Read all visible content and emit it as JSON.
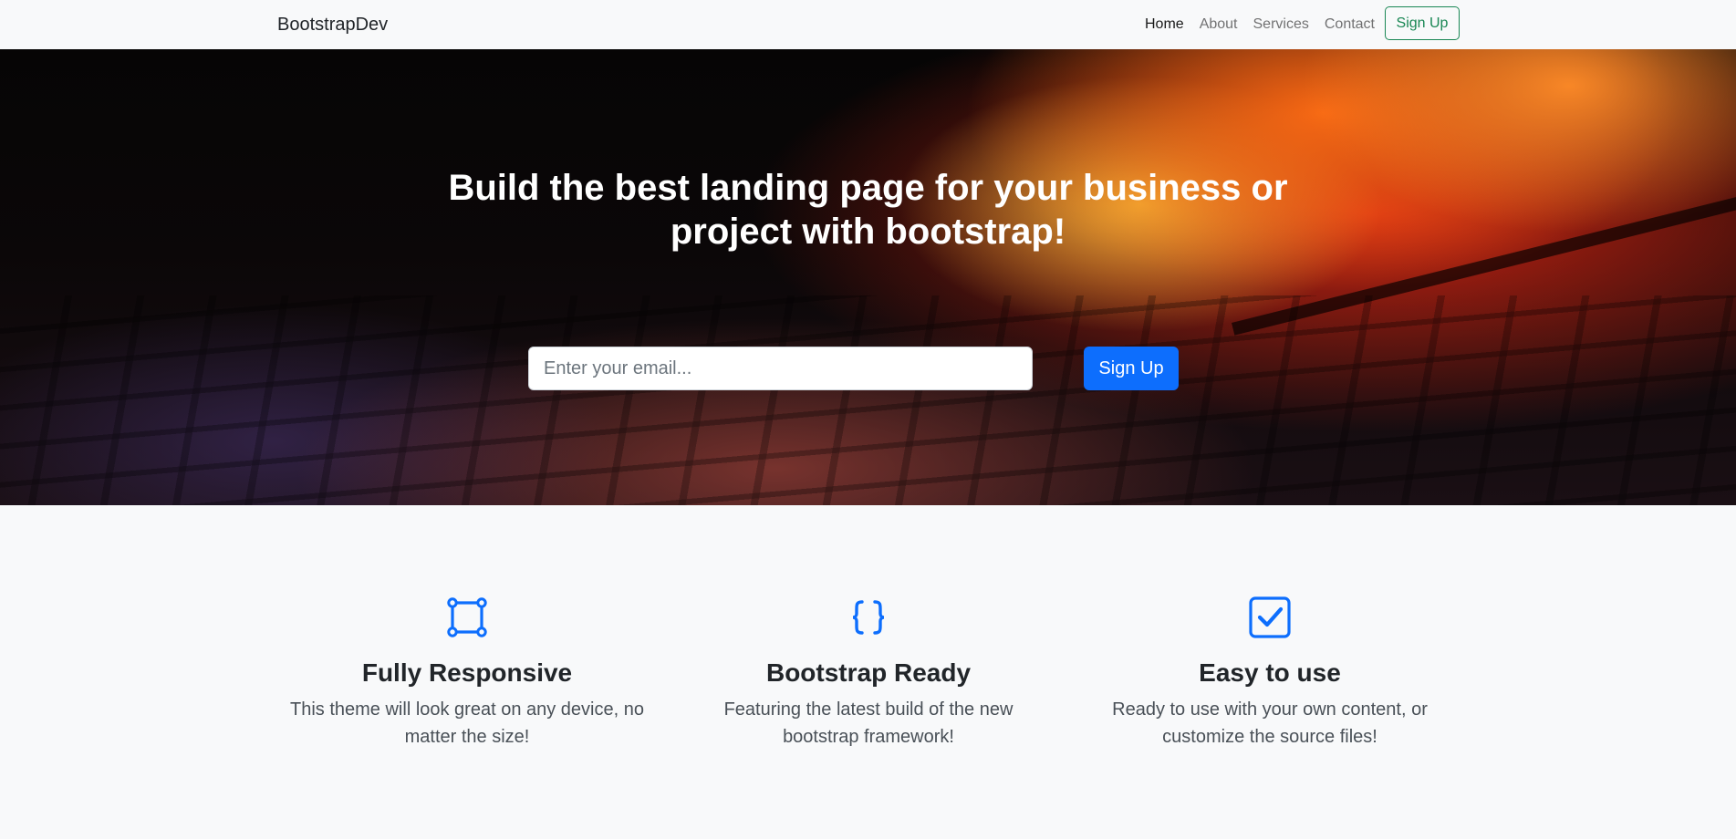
{
  "navbar": {
    "brand": "BootstrapDev",
    "links": [
      "Home",
      "About",
      "Services",
      "Contact"
    ],
    "signup_label": "Sign Up"
  },
  "hero": {
    "title": "Build the best landing page for your business or project with bootstrap!",
    "email_placeholder": "Enter your email...",
    "signup_label": "Sign Up"
  },
  "features": [
    {
      "icon": "bounding-box-icon",
      "title": "Fully Responsive",
      "text": "This theme will look great on any device, no matter the size!"
    },
    {
      "icon": "braces-icon",
      "title": "Bootstrap Ready",
      "text": "Featuring the latest build of the new bootstrap framework!"
    },
    {
      "icon": "check-square-icon",
      "title": "Easy to use",
      "text": "Ready to use with your own content, or customize the source files!"
    }
  ],
  "colors": {
    "accent": "#0d6efd",
    "success": "#198754",
    "background": "#f8f9fa",
    "icon": "#0d6efd"
  }
}
